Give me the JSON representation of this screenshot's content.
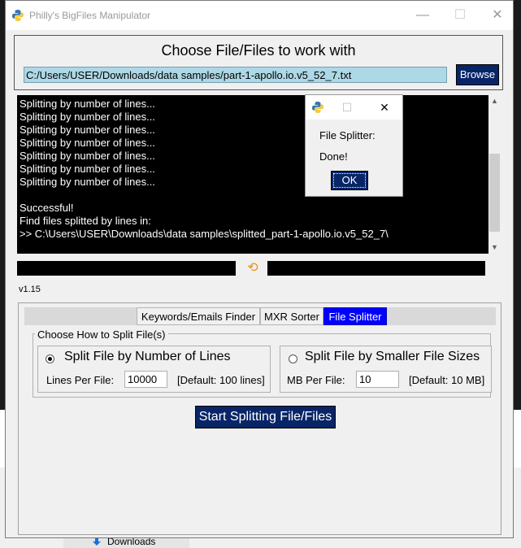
{
  "window": {
    "title": "Philly's BigFiles Manipulator",
    "controls": {
      "minimize": "—",
      "maximize": "☐",
      "close": "✕"
    }
  },
  "header": {
    "title": "Choose File/Files to work with",
    "file_path": "C:/Users/USER/Downloads/data samples/part-1-apollo.io.v5_52_7.txt",
    "browse_label": "Browse"
  },
  "console": {
    "lines": [
      "Splitting by number of lines...",
      "Splitting by number of lines...",
      "Splitting by number of lines...",
      "Splitting by number of lines...",
      "Splitting by number of lines...",
      "Splitting by number of lines...",
      "Splitting by number of lines...",
      "",
      "Successful!",
      "Find files splitted by lines in:",
      ">> C:\\Users\\USER\\Downloads\\data samples\\splitted_part-1-apollo.io.v5_52_7\\"
    ],
    "scroll_up_icon": "▲",
    "scroll_down_icon": "▼"
  },
  "status": {
    "refresh_icon": "⟲",
    "version": "v1.15"
  },
  "tabs": [
    {
      "label": "Keywords/Emails Finder",
      "active": false
    },
    {
      "label": "MXR Sorter",
      "active": false
    },
    {
      "label": "File Splitter",
      "active": true
    }
  ],
  "splitter": {
    "group_title": "Choose How to Split File(s)",
    "by_lines": {
      "label": "Split File by Number of Lines",
      "selected": true,
      "field_label": "Lines Per File:",
      "value": "10000",
      "default_note": "[Default: 100 lines]"
    },
    "by_size": {
      "label": "Split File by Smaller File Sizes",
      "selected": false,
      "field_label": "MB Per File:",
      "value": "10",
      "default_note": "[Default: 10 MB]"
    },
    "start_label": "Start Splitting File/Files"
  },
  "dialog": {
    "controls": {
      "maximize": "☐",
      "close": "✕"
    },
    "title": "File Splitter:",
    "message": "Done!",
    "ok_label": "OK"
  },
  "background": {
    "downloads_label": "Downloads"
  },
  "colors": {
    "button_navy": "#082567",
    "active_tab": "#0000ff",
    "path_field": "#add8e6",
    "console_bg": "#000000",
    "refresh_icon": "#e8901a"
  }
}
